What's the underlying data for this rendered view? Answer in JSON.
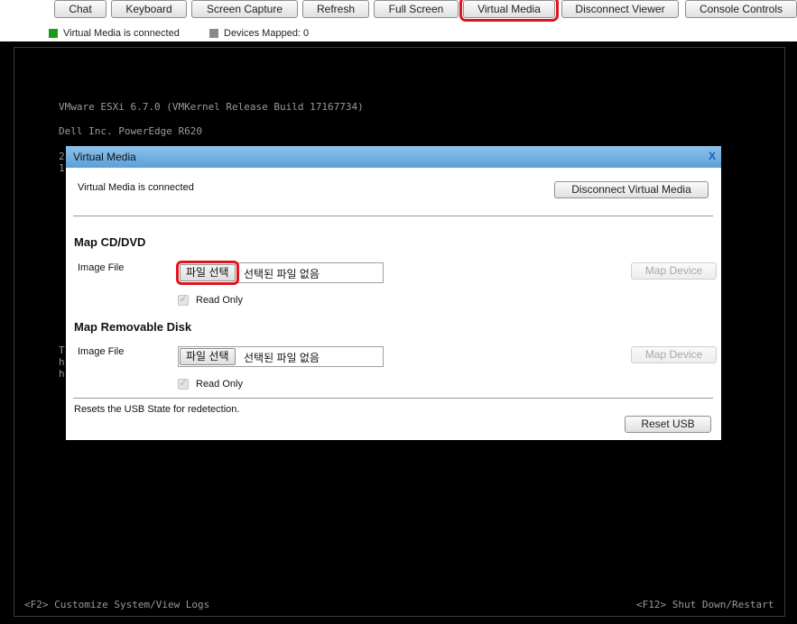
{
  "toolbar": {
    "chat": "Chat",
    "keyboard": "Keyboard",
    "screen_capture": "Screen Capture",
    "refresh": "Refresh",
    "full_screen": "Full Screen",
    "virtual_media": "Virtual Media",
    "disconnect_viewer": "Disconnect Viewer",
    "console_controls": "Console Controls"
  },
  "status": {
    "vm_connected": "Virtual Media is connected",
    "devices_mapped": "Devices Mapped: 0",
    "connected_color": "#1a9a1a",
    "devices_color": "#8a8a8a"
  },
  "console": {
    "line1": "VMware ESXi 6.7.0 (VMKernel Release Build 17167734)",
    "line2": "Dell Inc. PowerEdge R620",
    "frag1": "2",
    "frag2": "1",
    "frag3": "T",
    "frag4": "h",
    "frag5": "h",
    "footer_left": "<F2> Customize System/View Logs",
    "footer_right": "<F12> Shut Down/Restart"
  },
  "dialog": {
    "title": "Virtual Media",
    "close": "X",
    "connected_text": "Virtual Media is connected",
    "disconnect_button": "Disconnect Virtual Media",
    "cd": {
      "heading": "Map CD/DVD",
      "image_file_label": "Image File",
      "choose_button": "파일 선택",
      "no_file": "선택된 파일 없음",
      "read_only": "Read Only",
      "map_button": "Map Device"
    },
    "disk": {
      "heading": "Map Removable Disk",
      "image_file_label": "Image File",
      "choose_button": "파일 선택",
      "no_file": "선택된 파일 없음",
      "read_only": "Read Only",
      "map_button": "Map Device"
    },
    "reset_text": "Resets the USB State for redetection.",
    "reset_button": "Reset USB"
  }
}
